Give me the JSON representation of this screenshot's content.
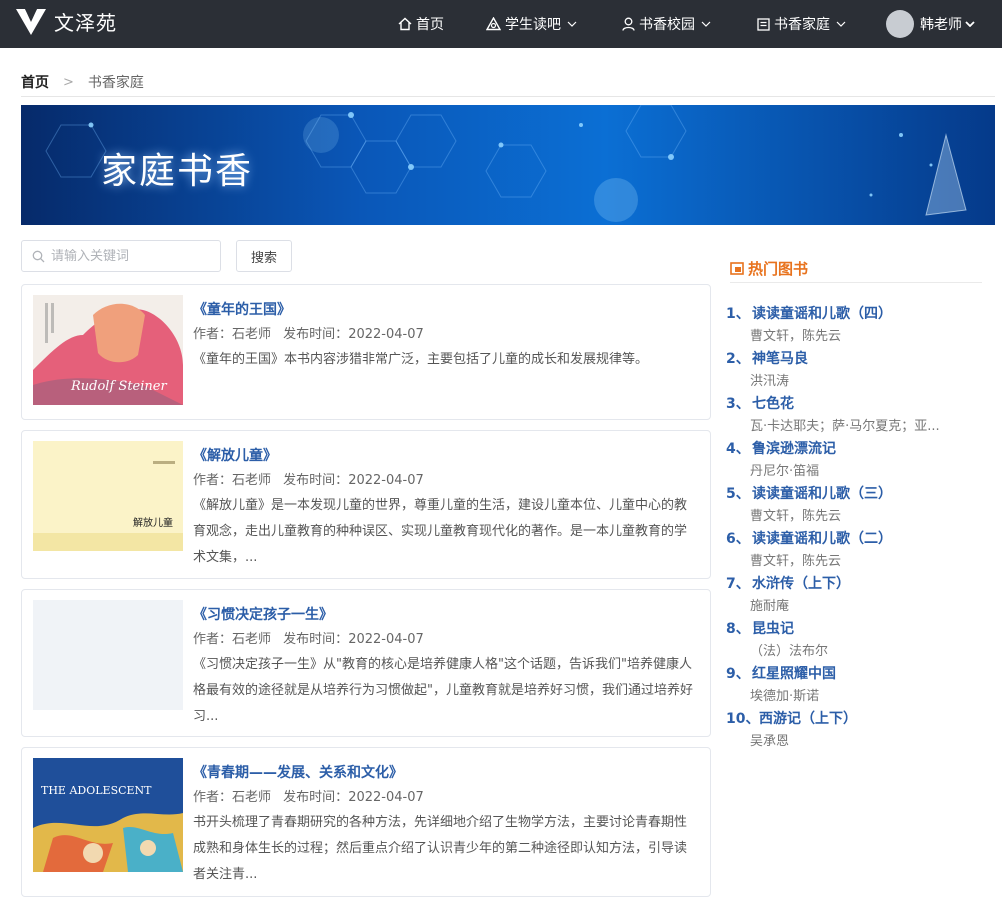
{
  "brand": {
    "name": "文泽苑"
  },
  "nav": {
    "home": "首页",
    "student": "学生读吧",
    "campus": "书香校园",
    "family": "书香家庭",
    "user": "韩老师"
  },
  "breadcrumb": {
    "home": "首页",
    "current": "书香家庭"
  },
  "banner": {
    "title": "家庭书香"
  },
  "search": {
    "placeholder": "请输入关键词",
    "button": "搜索"
  },
  "books": [
    {
      "title": "《童年的王国》",
      "author_label": "作者：",
      "author": "石老师",
      "date_label": "发布时间：",
      "date": "2022-04-07",
      "desc": "《童年的王国》本书内容涉猎非常广泛，主要包括了儿童的成长和发展规律等。",
      "cover_text": "Rudolf Steiner"
    },
    {
      "title": "《解放儿童》",
      "author_label": "作者：",
      "author": "石老师",
      "date_label": "发布时间：",
      "date": "2022-04-07",
      "desc": "《解放儿童》是一本发现儿童的世界，尊重儿童的生活，建设儿童本位、儿童中心的教育观念，走出儿童教育的种种误区、实现儿童教育现代化的著作。是一本儿童教育的学术文集，...",
      "cover_text": "解放儿童"
    },
    {
      "title": "《习惯决定孩子一生》",
      "author_label": "作者：",
      "author": "石老师",
      "date_label": "发布时间：",
      "date": "2022-04-07",
      "desc": "《习惯决定孩子一生》从\"教育的核心是培养健康人格\"这个话题，告诉我们\"培养健康人格最有效的途径就是从培养行为习惯做起\"，儿童教育就是培养好习惯，我们通过培养好习...",
      "cover_text": ""
    },
    {
      "title": "《青春期——发展、关系和文化》",
      "author_label": "作者：",
      "author": "石老师",
      "date_label": "发布时间：",
      "date": "2022-04-07",
      "desc": "书开头梳理了青春期研究的各种方法，先详细地介绍了生物学方法，主要讨论青春期性成熟和身体生长的过程；然后重点介绍了认识青少年的第二种途径即认知方法，引导读者关注青...",
      "cover_text": "THE ADOLESCENT"
    }
  ],
  "hot": {
    "title": "热门图书",
    "items": [
      {
        "num": "1、",
        "title": "读读童谣和儿歌（四）",
        "author": "曹文轩，陈先云"
      },
      {
        "num": "2、",
        "title": "神笔马良",
        "author": "洪汛涛"
      },
      {
        "num": "3、",
        "title": "七色花",
        "author": "瓦·卡达耶夫；萨·马尔夏克；亚..."
      },
      {
        "num": "4、",
        "title": "鲁滨逊漂流记",
        "author": "丹尼尔·笛福"
      },
      {
        "num": "5、",
        "title": "读读童谣和儿歌（三）",
        "author": "曹文轩，陈先云"
      },
      {
        "num": "6、",
        "title": "读读童谣和儿歌（二）",
        "author": "曹文轩，陈先云"
      },
      {
        "num": "7、",
        "title": "水浒传（上下）",
        "author": "施耐庵"
      },
      {
        "num": "8、",
        "title": "昆虫记",
        "author": "（法）法布尔"
      },
      {
        "num": "9、",
        "title": "红星照耀中国",
        "author": "埃德加·斯诺"
      },
      {
        "num": "10、",
        "title": "西游记（上下）",
        "author": "吴承恩"
      }
    ]
  }
}
